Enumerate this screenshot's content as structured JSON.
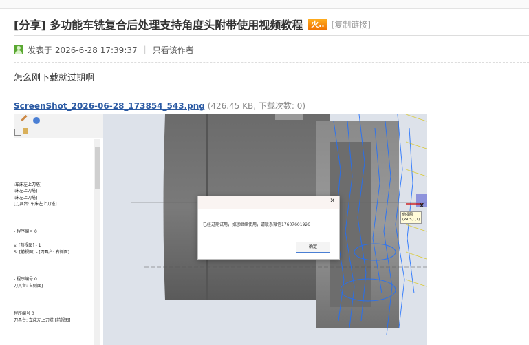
{
  "post": {
    "title": "[分享] 多功能车铣复合后处理支持角度头附带使用视频教程",
    "hot_badge": "火..",
    "copy_link": "[复制链接]",
    "posted_label": "发表于 2026-6-28 17:39:37",
    "separator": "|",
    "only_author": "只看该作者",
    "body_text": "怎么刚下载就过期啊"
  },
  "attachment": {
    "filename": "ScreenShot_2026-06-28_173854_543.png",
    "info": "(426.45 KB, 下载次数: 0)"
  },
  "screenshot": {
    "tree_lines": [
      ":车床左上刀塔]",
      ":床左上刀塔]",
      ":床左上刀塔]",
      "[刀具台: 车床左上刀塔]",
      "- 程序编号 0",
      "s: [前视图] - 1",
      "S: [前视图] - [刀具台: 右侧面]",
      "- 程序编号 0",
      "刀具台: 右侧面]",
      "程序编号 0",
      "刀具台: 车床左上刀塔 [前视图]"
    ],
    "dialog": {
      "close": "✕",
      "message": "已经过期试用，如想继续使用，请联系微信17607601926",
      "ok": "确定"
    },
    "wcs_label_1": "俯视图",
    "wcs_label_2": "(WCS,C,T)",
    "axis_x": "X"
  },
  "colors": {
    "link": "#2b5aa3",
    "badge": "#f07000",
    "toolpath": "#1e6fff"
  }
}
